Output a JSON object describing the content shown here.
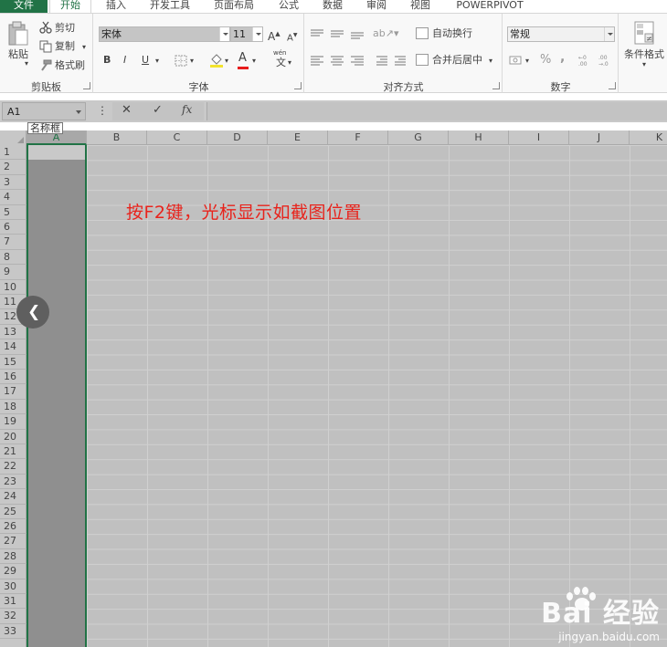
{
  "ribbon": {
    "tabs": [
      {
        "label": "文件"
      },
      {
        "label": "开始"
      },
      {
        "label": "插入"
      },
      {
        "label": "开发工具"
      },
      {
        "label": "页面布局"
      },
      {
        "label": "公式"
      },
      {
        "label": "数据"
      },
      {
        "label": "审阅"
      },
      {
        "label": "视图"
      },
      {
        "label": "POWERPIVOT"
      }
    ],
    "clipboard": {
      "group_label": "剪贴板",
      "paste_label": "粘贴",
      "cut_label": "剪切",
      "copy_label": "复制",
      "format_painter_label": "格式刷"
    },
    "font": {
      "group_label": "字体",
      "font_name": "宋体",
      "font_size": "11",
      "bold": "B",
      "italic": "I",
      "underline": "U",
      "font_color_letter": "A",
      "wen_label": "wén",
      "wen_char": "文"
    },
    "alignment": {
      "group_label": "对齐方式",
      "wrap_text_label": "自动换行",
      "merge_center_label": "合并后居中"
    },
    "number": {
      "group_label": "数字",
      "format_value": "常规",
      "percent": "%",
      "comma": ","
    },
    "styles": {
      "conditional_format_label": "条件格式"
    }
  },
  "formula_bar": {
    "name_box": "A1",
    "name_box_tooltip": "名称框",
    "more": "⋮",
    "cancel": "✕",
    "confirm": "✓",
    "fx": "fx"
  },
  "grid": {
    "columns": [
      "A",
      "B",
      "C",
      "D",
      "E",
      "F",
      "G",
      "H",
      "I",
      "J",
      "K"
    ],
    "rows": [
      "1",
      "2",
      "3",
      "4",
      "5",
      "6",
      "7",
      "8",
      "9",
      "10",
      "11",
      "12",
      "13",
      "14",
      "15",
      "16",
      "17",
      "18",
      "19",
      "20",
      "21",
      "22",
      "23",
      "24",
      "25",
      "26",
      "27",
      "28",
      "29",
      "30",
      "31",
      "32",
      "33"
    ],
    "selected_column": "A"
  },
  "annotation": {
    "text": "按F2键，光标显示如截图位置"
  },
  "watermark": {
    "logo": "Bai 经验",
    "url": "jingyan.baidu.com"
  },
  "colors": {
    "accent": "#217346",
    "annotation": "#e8231c"
  }
}
